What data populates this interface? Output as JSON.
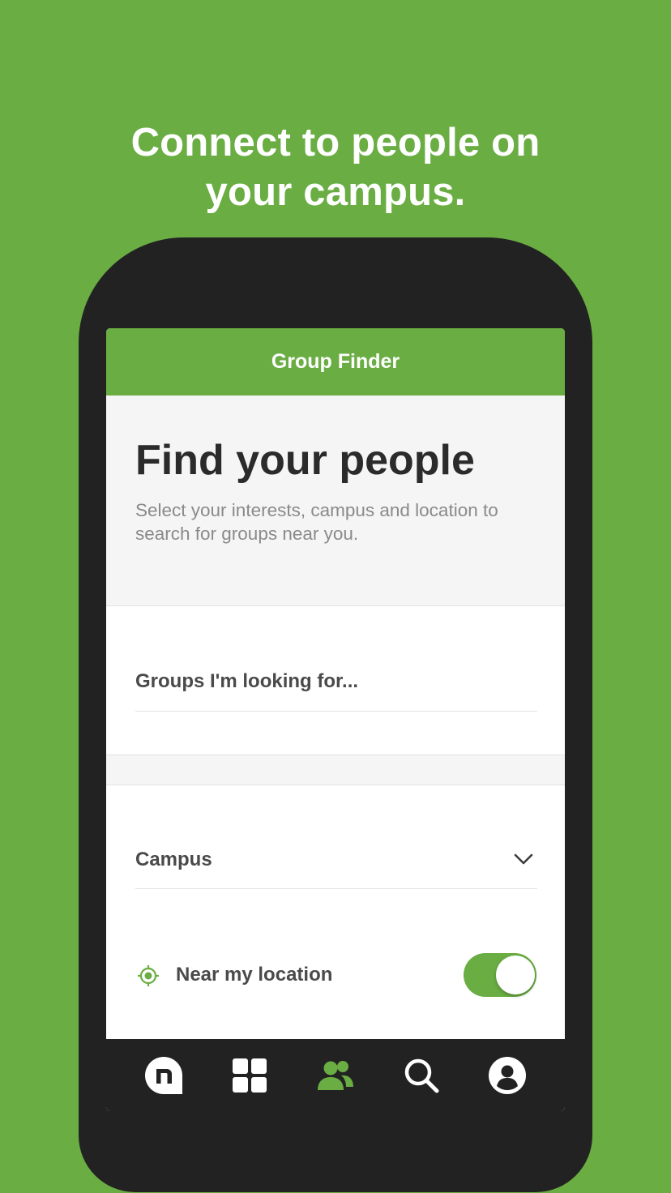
{
  "promo": {
    "headline_line1": "Connect to people on",
    "headline_line2": "your campus."
  },
  "app": {
    "header_title": "Group Finder",
    "hero": {
      "title": "Find your people",
      "subtitle": "Select your interests, campus and location to search for groups near you."
    },
    "interests_field": {
      "label": "Groups I'm looking for..."
    },
    "campus_field": {
      "label": "Campus",
      "icon": "chevron-down-icon"
    },
    "location_toggle": {
      "label": "Near my location",
      "icon": "location-target-icon",
      "enabled": true
    }
  },
  "tabbar": {
    "tabs": [
      {
        "name": "home",
        "icon": "app-logo-icon",
        "active": false
      },
      {
        "name": "discover",
        "icon": "grid-icon",
        "active": false
      },
      {
        "name": "groups",
        "icon": "people-icon",
        "active": true
      },
      {
        "name": "search",
        "icon": "search-icon",
        "active": false
      },
      {
        "name": "profile",
        "icon": "profile-icon",
        "active": false
      }
    ]
  },
  "colors": {
    "brand_green": "#6aad43",
    "device_dark": "#222222",
    "text_dark": "#2b2b2b",
    "text_muted": "#8a8a8a"
  }
}
